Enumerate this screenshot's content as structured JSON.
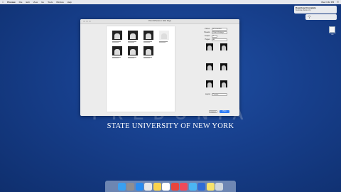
{
  "menubar": {
    "apple": "",
    "app_name": "Preview",
    "items": [
      "File",
      "Edit",
      "View",
      "Go",
      "Tools",
      "Window",
      "Help"
    ],
    "status": [
      "Wed 3:42 PM",
      "☰"
    ]
  },
  "notifications": [
    {
      "title": "Download Complete",
      "body": "fredonia-photos.zip"
    }
  ],
  "desktop_icon": {
    "label": "Macintosh HD"
  },
  "background": {
    "ghost_text": "FREDONIA",
    "wordmark": "STATE UNIVERSITY OF NEW YORK"
  },
  "print_dialog": {
    "title": "Print 8 Photos in Web Page",
    "printer_label": "Printer:",
    "printer_value": "HP LaserJet",
    "presets_label": "Presets:",
    "presets_value": "Default Settings",
    "copies_label": "Copies:",
    "copies_value": "1",
    "pages_label": "Pages:",
    "pages_value": "All",
    "layout_label": "Layout",
    "layout_value": "Preview",
    "cancel_label": "Cancel",
    "print_label": "Print",
    "thumb_count": 8,
    "colors": {
      "primary": "#2f7cf6"
    }
  },
  "dock": {
    "apps": [
      "finder",
      "launchpad",
      "safari",
      "mail",
      "photos",
      "calendar",
      "chrome",
      "music",
      "preview",
      "help",
      "notes",
      "trash"
    ],
    "colors": [
      "#3aa0f0",
      "#8e8e93",
      "#2a8cf0",
      "#e8e8e8",
      "#fbd34c",
      "#ffffff",
      "#e8453c",
      "#f04a5a",
      "#4bb6f3",
      "#2f6bd6",
      "#f7e26b",
      "#cfd6de"
    ]
  }
}
